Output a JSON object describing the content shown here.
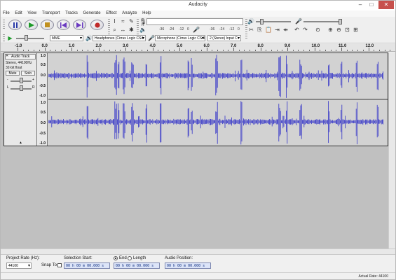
{
  "window": {
    "title": "Audacity"
  },
  "menu": [
    "File",
    "Edit",
    "View",
    "Transport",
    "Tracks",
    "Generate",
    "Effect",
    "Analyze",
    "Help"
  ],
  "meters": {
    "record_scale": [
      "L",
      "R",
      "-36",
      "-24",
      "-12",
      "0"
    ],
    "play_scale": [
      "-36",
      "-24",
      "-12",
      "0"
    ]
  },
  "devices": {
    "host": "MME",
    "output": "Headphones (Cirrus Logic CS4",
    "input": "Microphone (Cirrus Logic CS4I",
    "channels": "2 (Stereo) Input C"
  },
  "ruler": {
    "labels": [
      "-1.0",
      "0.0",
      "1.0",
      "2.0",
      "3.0",
      "4.0",
      "5.0",
      "6.0",
      "7.0",
      "8.0",
      "9.0",
      "10.0",
      "11.0",
      "12.0"
    ]
  },
  "track": {
    "name": "Audio Track",
    "info1": "Stereo, 44100Hz",
    "info2": "32-bit float",
    "mute": "Mute",
    "solo": "Solo",
    "pan_L": "L",
    "pan_R": "R",
    "scale": [
      "1.0",
      "0.5",
      "0.0",
      "-0.5",
      "-1.0"
    ]
  },
  "selection": {
    "project_rate_label": "Project Rate (Hz):",
    "project_rate": "44100",
    "snap_to": "Snap To",
    "selection_start_label": "Selection Start:",
    "end_label": "End",
    "length_label": "Length",
    "audio_position_label": "Audio Position:",
    "start_value": "00 h 00 m 00.000 s",
    "end_value": "00 h 00 m 00.000 s",
    "position_value": "00 h 00 m 00.000 s"
  },
  "status": {
    "actual_rate": "Actual Rate: 44100"
  },
  "colors": {
    "waveform": "#3232c8",
    "track_bg": "#d8d8d8"
  },
  "icons": [
    "pause-icon",
    "play-icon",
    "stop-icon",
    "skip-start-icon",
    "skip-end-icon",
    "record-icon"
  ]
}
